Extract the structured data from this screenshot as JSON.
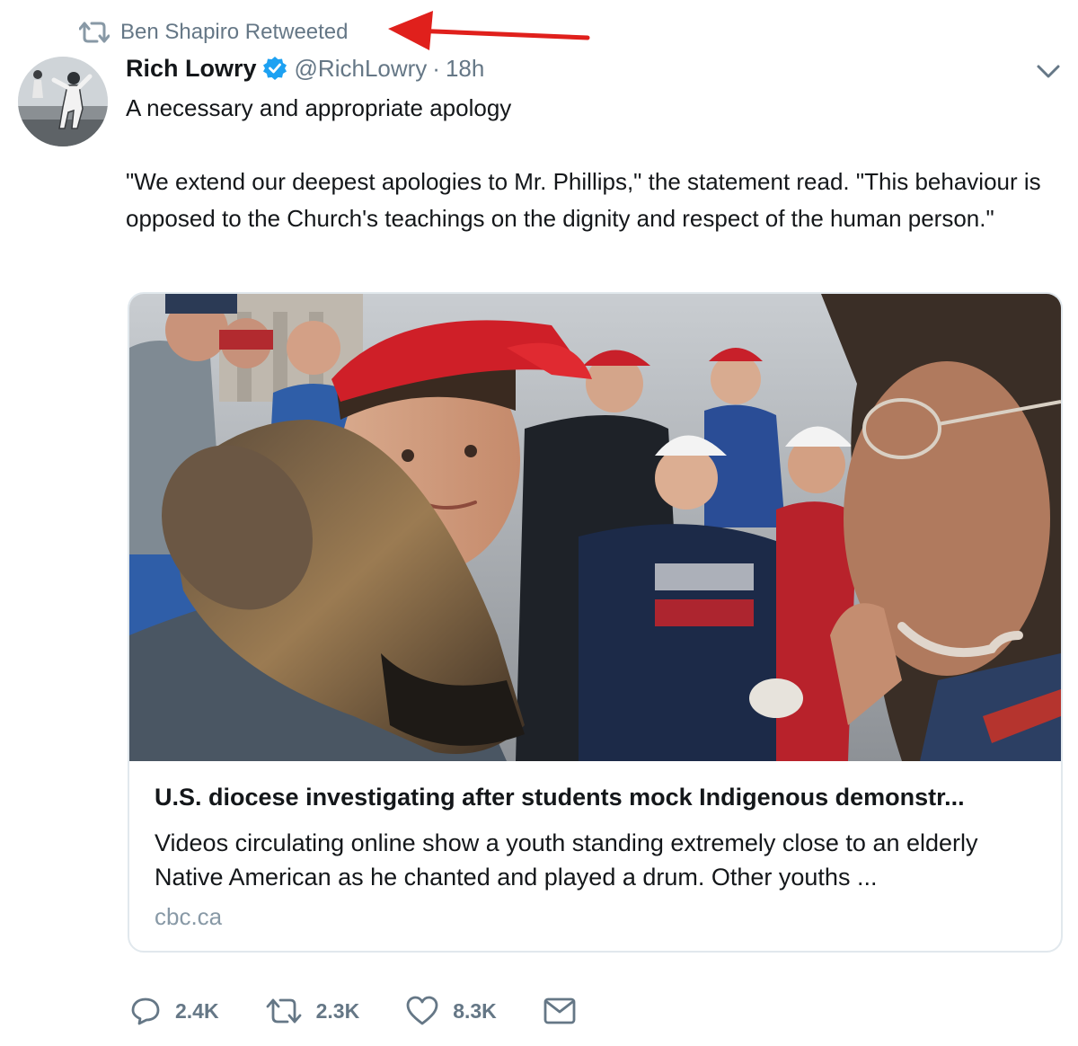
{
  "retweet_header": {
    "text": "Ben Shapiro Retweeted",
    "icon": "retweet-icon"
  },
  "annotation": {
    "type": "red-arrow",
    "color": "#e0201c"
  },
  "tweet": {
    "author_name": "Rich Lowry",
    "verified": true,
    "handle": "@RichLowry",
    "separator": "·",
    "timestamp": "18h",
    "text_line1": "A necessary and appropriate apology",
    "text_quote": "\"We extend our deepest apologies to Mr. Phillips,\" the statement read. \"This behaviour is opposed to the Church's teachings on the dignity and respect of the human person.\""
  },
  "card": {
    "title": "U.S. diocese investigating after students mock Indigenous demonstr...",
    "description": "Videos circulating online show a youth standing extremely close to an elderly Native American as he chanted and played a drum. Other youths ...",
    "domain": "cbc.ca"
  },
  "actions": {
    "replies": "2.4K",
    "retweets": "2.3K",
    "likes": "8.3K"
  },
  "colors": {
    "text": "#14171a",
    "secondary": "#657786",
    "verified_blue": "#1da1f2",
    "border": "#e1e8ed",
    "domain": "#8899a6",
    "cap_red": "#d32027"
  }
}
